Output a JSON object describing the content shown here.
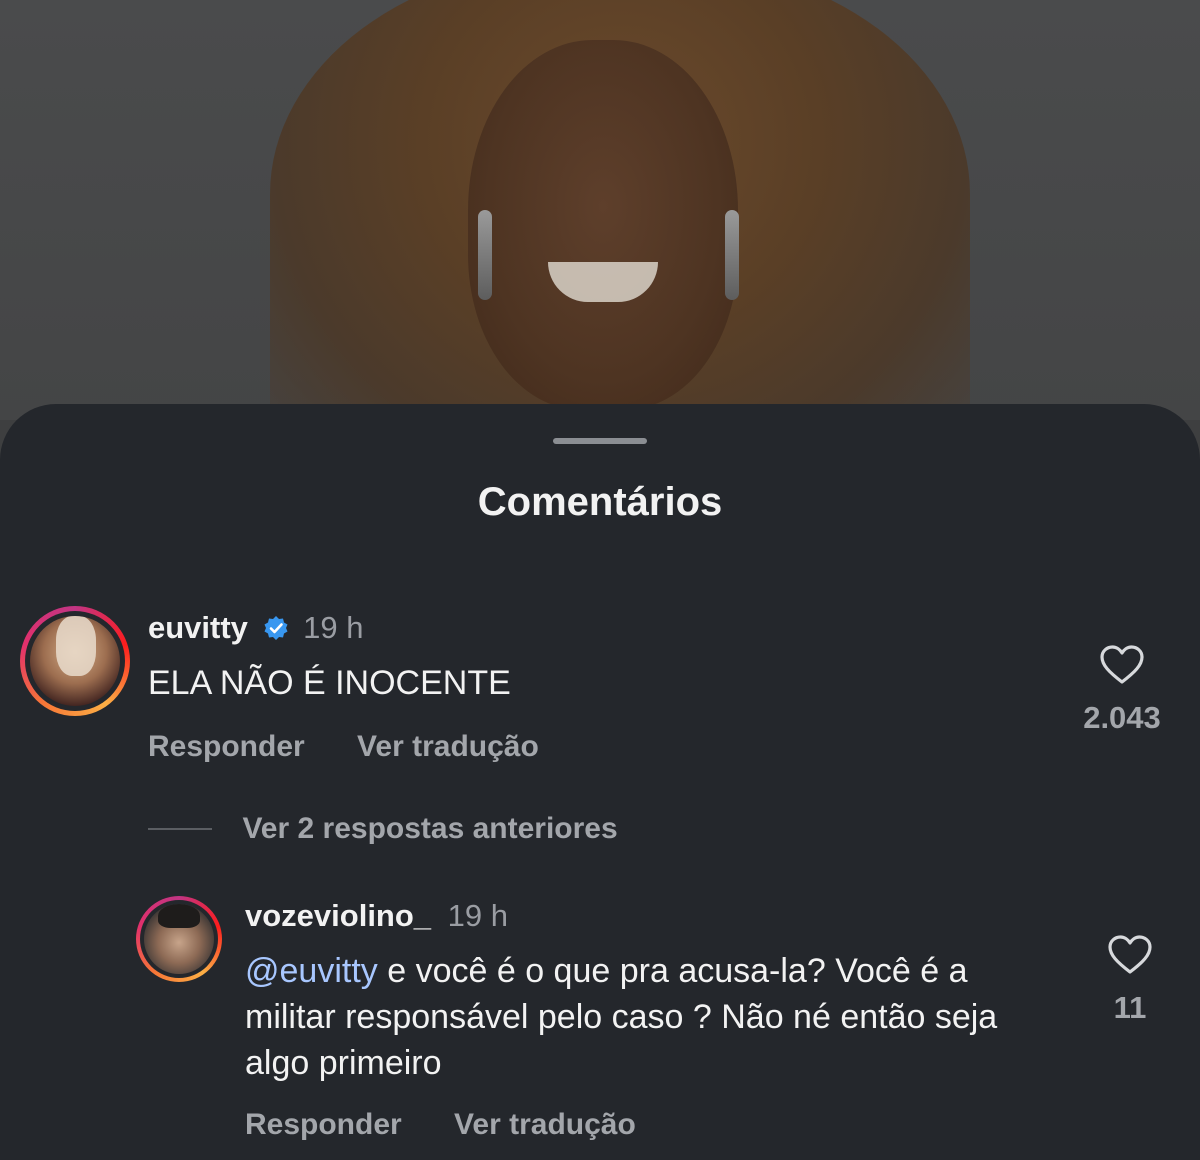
{
  "sheet": {
    "title": "Comentários"
  },
  "comments": [
    {
      "username": "euvitty",
      "verified": true,
      "time": "19 h",
      "text": "ELA NÃO É INOCENTE",
      "likes": "2.043",
      "reply_label": "Responder",
      "translate_label": "Ver tradução"
    }
  ],
  "replies_toggle": {
    "label": "Ver 2 respostas anteriores"
  },
  "reply": {
    "username": "vozeviolino_",
    "time": "19 h",
    "mention": "@euvitty",
    "text": " e você é o que  pra acusa-la? Você é a militar responsável pelo caso ? Não né então seja algo primeiro",
    "likes": "11",
    "reply_label": "Responder",
    "translate_label": "Ver tradução"
  },
  "icons": {
    "verified": "verified-badge-icon",
    "like": "heart-icon"
  },
  "colors": {
    "sheet_background": "#24272c",
    "mention": "#a8c7ff",
    "verified_badge": "#3897f0"
  }
}
